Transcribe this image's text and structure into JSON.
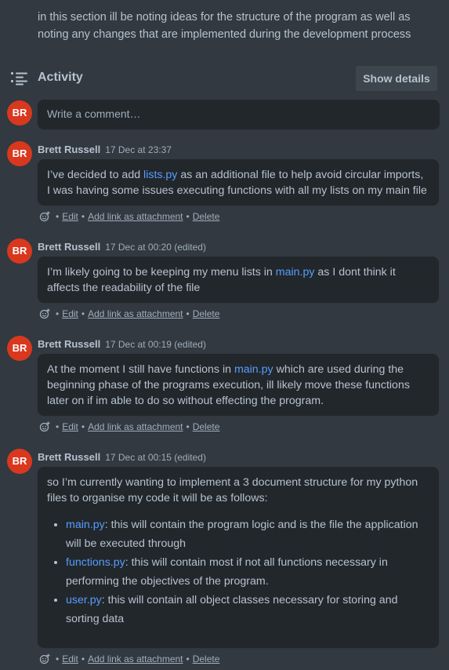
{
  "description": "in this section ill be noting ideas for the structure of the program as well as noting any changes that are implemented during the development process",
  "activity": {
    "title": "Activity",
    "show_details_label": "Show details"
  },
  "user_initials": "BR",
  "comment_placeholder": "Write a comment…",
  "actions": {
    "edit": "Edit",
    "add_link": "Add link as attachment",
    "delete": "Delete",
    "separator": "•"
  },
  "comments": [
    {
      "author": "Brett Russell",
      "time": "17 Dec at 23:37",
      "parts": [
        "I’ve decided to add ",
        "lists.py",
        " as an additional file to help avoid circular imports, I was having some issues executing functions with all my lists on my main file"
      ]
    },
    {
      "author": "Brett Russell",
      "time": "17 Dec at 00:20 (edited)",
      "parts": [
        "I’m likely going to be keeping my menu lists in ",
        "main.py",
        " as I dont think it affects the readability of the file"
      ]
    },
    {
      "author": "Brett Russell",
      "time": "17 Dec at 00:19 (edited)",
      "parts": [
        "At the moment I still have functions in ",
        "main.py",
        " which are used during the beginning phase of the programs execution, ill likely move these functions later on if im able to do so without effecting the program."
      ]
    },
    {
      "author": "Brett Russell",
      "time": "17 Dec at 00:15 (edited)",
      "intro": "so I’m currently wanting to implement a 3 document structure for my python files to organise my code it will be as follows:",
      "items": [
        {
          "link": "main.py",
          "text": ": this will contain the program logic and is the file the application will be executed through"
        },
        {
          "link": "functions.py",
          "text": ": this will contain most if not all functions necessary in performing the objectives of the program."
        },
        {
          "link": "user.py",
          "text": ": this will contain all object classes necessary for storing and sorting data"
        }
      ]
    }
  ],
  "colors": {
    "background": "#323940",
    "card": "#22272b",
    "text": "#b6c2cf",
    "link": "#579dff",
    "avatar": "#d9381e"
  }
}
